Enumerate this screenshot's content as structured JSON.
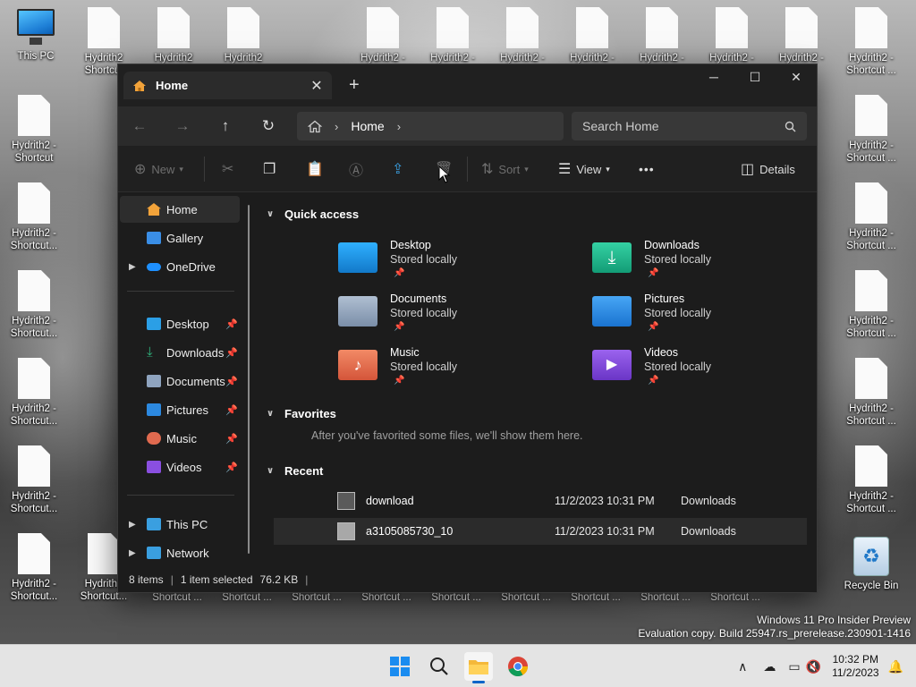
{
  "desktop": {
    "this_pc_label": "This PC",
    "recycle_bin_label": "Recycle Bin",
    "shortcut_labels": {
      "top_a": "Hydrith2 -",
      "top_b": "Shortcut",
      "short_a": "Hydrith2 -",
      "short_b": "Shortcut",
      "dots_b": "Shortcut ...",
      "ell_b": "Shortcut...",
      "hyd": "Hydrith2",
      "bottom": "Shortcut ..."
    },
    "watermark_line1": "Windows 11 Pro Insider Preview",
    "watermark_line2": "Evaluation copy. Build 25947.rs_prerelease.230901-1416"
  },
  "window": {
    "tab_title": "Home",
    "new_tab": "+",
    "minimize": "─",
    "maximize": "☐",
    "close": "✕",
    "address": {
      "crumb": "Home"
    },
    "search_placeholder": "Search Home",
    "toolbar": {
      "new_label": "New",
      "sort_label": "Sort",
      "view_label": "View",
      "more_label": "•••",
      "details_label": "Details"
    },
    "sidebar": {
      "items": [
        {
          "label": "Home",
          "icon": "home-icon",
          "color": "#f2a33a"
        },
        {
          "label": "Gallery",
          "icon": "gallery-icon",
          "color": "#3a8ee6"
        },
        {
          "label": "OneDrive",
          "icon": "onedrive-icon",
          "color": "#1e90ff"
        },
        {
          "label": "Desktop",
          "icon": "desktop-folder-icon",
          "color": "#2b9fe6"
        },
        {
          "label": "Downloads",
          "icon": "downloads-icon",
          "color": "#2fb37c"
        },
        {
          "label": "Documents",
          "icon": "documents-icon",
          "color": "#8fa4bf"
        },
        {
          "label": "Pictures",
          "icon": "pictures-icon",
          "color": "#2c89e0"
        },
        {
          "label": "Music",
          "icon": "music-icon",
          "color": "#e06a4f"
        },
        {
          "label": "Videos",
          "icon": "videos-icon",
          "color": "#8a4fe0"
        },
        {
          "label": "This PC",
          "icon": "this-pc-icon",
          "color": "#3a9fe0"
        },
        {
          "label": "Network",
          "icon": "network-icon",
          "color": "#3a9fe0"
        }
      ]
    },
    "quick_access": {
      "title": "Quick access",
      "items": [
        {
          "name": "Desktop",
          "sub": "Stored locally",
          "color": "#1e9be0"
        },
        {
          "name": "Downloads",
          "sub": "Stored locally",
          "color": "#20b38a"
        },
        {
          "name": "Documents",
          "sub": "Stored locally",
          "color": "#8e9fb6"
        },
        {
          "name": "Pictures",
          "sub": "Stored locally",
          "color": "#2e8fe6"
        },
        {
          "name": "Music",
          "sub": "Stored locally",
          "color": "#e8705a"
        },
        {
          "name": "Videos",
          "sub": "Stored locally",
          "color": "#7a45d6"
        }
      ]
    },
    "favorites": {
      "title": "Favorites",
      "note": "After you've favorited some files, we'll show them here."
    },
    "recent": {
      "title": "Recent",
      "rows": [
        {
          "name": "download",
          "date": "11/2/2023 10:31 PM",
          "location": "Downloads"
        },
        {
          "name": "a3105085730_10",
          "date": "11/2/2023 10:31 PM",
          "location": "Downloads"
        }
      ]
    },
    "status": {
      "items": "8 items",
      "selected": "1 item selected",
      "size": "76.2 KB"
    }
  },
  "taskbar": {
    "time": "10:32 PM",
    "date": "11/2/2023"
  }
}
